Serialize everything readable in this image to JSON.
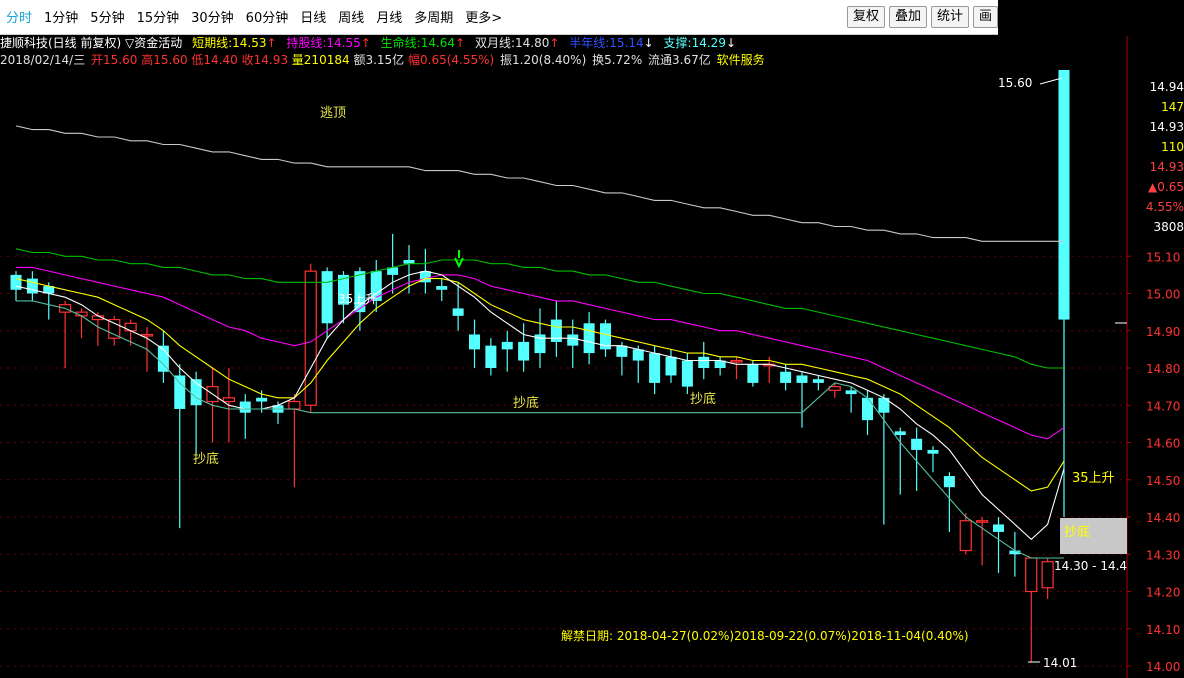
{
  "toolbar": {
    "periods": [
      "分时",
      "1分钟",
      "5分钟",
      "15分钟",
      "30分钟",
      "60分钟",
      "日线",
      "周线",
      "月线",
      "多周期",
      "更多>"
    ],
    "active_period": "分时",
    "buttons": [
      "复权",
      "叠加",
      "统计",
      "画"
    ]
  },
  "info_line1": {
    "title": "捷顺科技(日线 前复权) ▽资金活动",
    "short_label": "短期线:",
    "short_value": "14.53",
    "short_arrow": "↑",
    "hold_label": "持股线:",
    "hold_value": "14.55",
    "hold_arrow": "↑",
    "life_label": "生命线:",
    "life_value": "14.64",
    "life_arrow": "↑",
    "double_label": "双月线:",
    "double_value": "14.80",
    "double_arrow": "↑",
    "half_label": "半年线:",
    "half_value": "15.14",
    "half_arrow": "↓",
    "support_label": "支撑:",
    "support_value": "14.29",
    "support_arrow": "↓"
  },
  "info_line2": {
    "date": "2018/02/14/三",
    "open": "开15.60",
    "high": "高15.60",
    "low": "低14.40",
    "close": "收14.93",
    "volume": "量210184",
    "amount": "额3.15亿",
    "range": "幅0.65(4.55%)",
    "amplitude": "振1.20(8.40%)",
    "turnover": "换5.72%",
    "float": "流通3.67亿",
    "industry": "软件服务"
  },
  "right_panel": {
    "values": [
      "14.94",
      "147",
      "14.93",
      "110",
      "14.93",
      "▲0.65",
      "4.55%",
      "3808"
    ],
    "colors": [
      "#ffffff",
      "#ffff00",
      "#ffffff",
      "#ffff00",
      "#ff4040",
      "#ff4040",
      "#ff4040",
      "#ffffff"
    ]
  },
  "annotations": {
    "escape_top": "逃顶",
    "bottom1": "抄底",
    "bottom2": "抄底",
    "bottom3": "抄底",
    "bottom_box": "抄底",
    "rise1": "35上升",
    "rise2": "35上升",
    "max_price": "15.60",
    "min_price": "14.01",
    "support_range": "14.30 - 14.4",
    "unlock": "解禁日期: 2018-04-27(0.02%)2018-09-22(0.07%)2018-11-04(0.40%)"
  },
  "colors": {
    "up": "#ff3232",
    "down": "#54ffff",
    "short": "#ffffff",
    "hold": "#ffff00",
    "life": "#ff00ff",
    "double": "#00c000",
    "half": "#c8c8c8",
    "support": "#54c0a0",
    "axis": "#b00000"
  },
  "chart_data": {
    "type": "candlestick",
    "title": "捷顺科技(日线 前复权)",
    "ylim": [
      14.0,
      15.6
    ],
    "y_ticks": [
      15.1,
      15.0,
      14.9,
      14.8,
      14.7,
      14.6,
      14.5,
      14.4,
      14.3,
      14.2,
      14.1,
      14.0
    ],
    "candles": [
      {
        "o": 15.05,
        "h": 15.06,
        "c": 15.01,
        "l": 14.98
      },
      {
        "o": 15.04,
        "h": 15.06,
        "c": 15.0,
        "l": 14.98
      },
      {
        "o": 15.02,
        "h": 15.03,
        "c": 15.0,
        "l": 14.93
      },
      {
        "o": 14.95,
        "h": 14.98,
        "c": 14.97,
        "l": 14.8
      },
      {
        "o": 14.94,
        "h": 14.96,
        "c": 14.95,
        "l": 14.88
      },
      {
        "o": 14.93,
        "h": 14.95,
        "c": 14.94,
        "l": 14.86
      },
      {
        "o": 14.88,
        "h": 14.94,
        "c": 14.93,
        "l": 14.86
      },
      {
        "o": 14.9,
        "h": 14.93,
        "c": 14.92,
        "l": 14.86
      },
      {
        "o": 14.89,
        "h": 14.91,
        "c": 14.89,
        "l": 14.79
      },
      {
        "o": 14.86,
        "h": 14.9,
        "c": 14.79,
        "l": 14.76
      },
      {
        "o": 14.78,
        "h": 14.81,
        "c": 14.69,
        "l": 14.37
      },
      {
        "o": 14.77,
        "h": 14.79,
        "c": 14.7,
        "l": 14.57
      },
      {
        "o": 14.71,
        "h": 14.8,
        "c": 14.75,
        "l": 14.6
      },
      {
        "o": 14.71,
        "h": 14.8,
        "c": 14.72,
        "l": 14.6
      },
      {
        "o": 14.71,
        "h": 14.73,
        "c": 14.68,
        "l": 14.61
      },
      {
        "o": 14.72,
        "h": 14.74,
        "c": 14.71,
        "l": 14.68
      },
      {
        "o": 14.7,
        "h": 14.71,
        "c": 14.68,
        "l": 14.65
      },
      {
        "o": 14.69,
        "h": 14.73,
        "c": 14.71,
        "l": 14.48
      },
      {
        "o": 14.7,
        "h": 15.08,
        "c": 15.06,
        "l": 14.68
      },
      {
        "o": 15.06,
        "h": 15.07,
        "c": 14.92,
        "l": 14.88
      },
      {
        "o": 15.05,
        "h": 15.06,
        "c": 14.97,
        "l": 14.92
      },
      {
        "o": 15.06,
        "h": 15.07,
        "c": 14.95,
        "l": 14.9
      },
      {
        "o": 15.06,
        "h": 15.09,
        "c": 14.98,
        "l": 14.95
      },
      {
        "o": 15.07,
        "h": 15.16,
        "c": 15.05,
        "l": 15.0
      },
      {
        "o": 15.09,
        "h": 15.13,
        "c": 15.08,
        "l": 15.0
      },
      {
        "o": 15.06,
        "h": 15.12,
        "c": 15.03,
        "l": 15.0
      },
      {
        "o": 15.02,
        "h": 15.04,
        "c": 15.01,
        "l": 14.98
      },
      {
        "o": 14.96,
        "h": 15.03,
        "c": 14.94,
        "l": 14.9
      },
      {
        "o": 14.89,
        "h": 14.93,
        "c": 14.85,
        "l": 14.8
      },
      {
        "o": 14.86,
        "h": 14.88,
        "c": 14.8,
        "l": 14.78
      },
      {
        "o": 14.87,
        "h": 14.9,
        "c": 14.85,
        "l": 14.79
      },
      {
        "o": 14.87,
        "h": 14.92,
        "c": 14.82,
        "l": 14.79
      },
      {
        "o": 14.89,
        "h": 14.96,
        "c": 14.84,
        "l": 14.8
      },
      {
        "o": 14.93,
        "h": 14.98,
        "c": 14.87,
        "l": 14.83
      },
      {
        "o": 14.89,
        "h": 14.93,
        "c": 14.86,
        "l": 14.8
      },
      {
        "o": 14.92,
        "h": 14.95,
        "c": 14.84,
        "l": 14.81
      },
      {
        "o": 14.92,
        "h": 14.93,
        "c": 14.85,
        "l": 14.83
      },
      {
        "o": 14.86,
        "h": 14.87,
        "c": 14.83,
        "l": 14.78
      },
      {
        "o": 14.85,
        "h": 14.86,
        "c": 14.82,
        "l": 14.76
      },
      {
        "o": 14.84,
        "h": 14.86,
        "c": 14.76,
        "l": 14.73
      },
      {
        "o": 14.83,
        "h": 14.85,
        "c": 14.78,
        "l": 14.76
      },
      {
        "o": 14.82,
        "h": 14.84,
        "c": 14.75,
        "l": 14.73
      },
      {
        "o": 14.83,
        "h": 14.87,
        "c": 14.8,
        "l": 14.77
      },
      {
        "o": 14.82,
        "h": 14.83,
        "c": 14.8,
        "l": 14.78
      },
      {
        "o": 14.82,
        "h": 14.83,
        "c": 14.82,
        "l": 14.77
      },
      {
        "o": 14.81,
        "h": 14.82,
        "c": 14.76,
        "l": 14.75
      },
      {
        "o": 14.81,
        "h": 14.83,
        "c": 14.81,
        "l": 14.76
      },
      {
        "o": 14.79,
        "h": 14.81,
        "c": 14.76,
        "l": 14.74
      },
      {
        "o": 14.78,
        "h": 14.79,
        "c": 14.76,
        "l": 14.64
      },
      {
        "o": 14.77,
        "h": 14.78,
        "c": 14.76,
        "l": 14.74
      },
      {
        "o": 14.74,
        "h": 14.76,
        "c": 14.75,
        "l": 14.72
      },
      {
        "o": 14.74,
        "h": 14.75,
        "c": 14.73,
        "l": 14.68
      },
      {
        "o": 14.72,
        "h": 14.74,
        "c": 14.66,
        "l": 14.62
      },
      {
        "o": 14.72,
        "h": 14.73,
        "c": 14.68,
        "l": 14.38
      },
      {
        "o": 14.63,
        "h": 14.64,
        "c": 14.62,
        "l": 14.46
      },
      {
        "o": 14.61,
        "h": 14.64,
        "c": 14.58,
        "l": 14.47
      },
      {
        "o": 14.58,
        "h": 14.59,
        "c": 14.57,
        "l": 14.52
      },
      {
        "o": 14.51,
        "h": 14.52,
        "c": 14.48,
        "l": 14.36
      },
      {
        "o": 14.31,
        "h": 14.41,
        "c": 14.39,
        "l": 14.3
      },
      {
        "o": 14.39,
        "h": 14.4,
        "c": 14.39,
        "l": 14.27
      },
      {
        "o": 14.38,
        "h": 14.4,
        "c": 14.36,
        "l": 14.25
      },
      {
        "o": 14.31,
        "h": 14.36,
        "c": 14.3,
        "l": 14.24
      },
      {
        "o": 14.2,
        "h": 14.29,
        "c": 14.29,
        "l": 14.01
      },
      {
        "o": 14.21,
        "h": 14.29,
        "c": 14.28,
        "l": 14.18
      },
      {
        "o": 15.6,
        "h": 15.6,
        "c": 14.93,
        "l": 14.4
      }
    ],
    "ma_series": {
      "short": [
        15.02,
        15.01,
        15.0,
        14.99,
        14.97,
        14.94,
        14.92,
        14.9,
        14.88,
        14.85,
        14.8,
        14.76,
        14.73,
        14.7,
        14.69,
        14.69,
        14.7,
        14.72,
        14.8,
        14.88,
        14.93,
        14.97,
        15.0,
        15.03,
        15.05,
        15.06,
        15.05,
        15.02,
        14.99,
        14.95,
        14.92,
        14.89,
        14.88,
        14.88,
        14.88,
        14.87,
        14.86,
        14.86,
        14.85,
        14.84,
        14.83,
        14.82,
        14.82,
        14.82,
        14.81,
        14.81,
        14.81,
        14.8,
        14.79,
        14.78,
        14.77,
        14.76,
        14.74,
        14.72,
        14.69,
        14.65,
        14.62,
        14.58,
        14.52,
        14.46,
        14.42,
        14.38,
        14.34,
        14.38,
        14.53
      ],
      "hold": [
        15.04,
        15.03,
        15.02,
        15.01,
        15.0,
        14.99,
        14.97,
        14.95,
        14.93,
        14.9,
        14.86,
        14.83,
        14.8,
        14.77,
        14.75,
        14.73,
        14.72,
        14.72,
        14.76,
        14.82,
        14.87,
        14.92,
        14.96,
        14.99,
        15.02,
        15.04,
        15.04,
        15.03,
        15.0,
        14.97,
        14.95,
        14.93,
        14.92,
        14.91,
        14.91,
        14.9,
        14.89,
        14.88,
        14.87,
        14.86,
        14.85,
        14.84,
        14.84,
        14.83,
        14.83,
        14.82,
        14.82,
        14.81,
        14.81,
        14.8,
        14.79,
        14.78,
        14.77,
        14.75,
        14.73,
        14.7,
        14.67,
        14.64,
        14.6,
        14.56,
        14.53,
        14.5,
        14.47,
        14.48,
        14.55
      ],
      "life": [
        15.07,
        15.07,
        15.06,
        15.05,
        15.04,
        15.03,
        15.02,
        15.01,
        15.0,
        14.99,
        14.97,
        14.95,
        14.93,
        14.91,
        14.9,
        14.88,
        14.87,
        14.86,
        14.87,
        14.9,
        14.93,
        14.96,
        14.99,
        15.01,
        15.03,
        15.04,
        15.05,
        15.05,
        15.04,
        15.02,
        15.01,
        15.0,
        14.99,
        14.98,
        14.98,
        14.97,
        14.96,
        14.95,
        14.94,
        14.93,
        14.93,
        14.92,
        14.91,
        14.9,
        14.9,
        14.89,
        14.88,
        14.87,
        14.86,
        14.85,
        14.84,
        14.83,
        14.82,
        14.8,
        14.78,
        14.76,
        14.74,
        14.72,
        14.7,
        14.68,
        14.66,
        14.64,
        14.62,
        14.61,
        14.64
      ],
      "double": [
        15.12,
        15.11,
        15.11,
        15.1,
        15.1,
        15.09,
        15.09,
        15.08,
        15.08,
        15.07,
        15.07,
        15.06,
        15.05,
        15.05,
        15.04,
        15.04,
        15.03,
        15.03,
        15.03,
        15.03,
        15.04,
        15.05,
        15.06,
        15.07,
        15.08,
        15.08,
        15.09,
        15.09,
        15.09,
        15.08,
        15.08,
        15.07,
        15.07,
        15.06,
        15.06,
        15.05,
        15.05,
        15.04,
        15.03,
        15.03,
        15.02,
        15.01,
        15.0,
        15.0,
        14.99,
        14.98,
        14.97,
        14.96,
        14.96,
        14.95,
        14.94,
        14.93,
        14.92,
        14.91,
        14.9,
        14.89,
        14.88,
        14.87,
        14.86,
        14.85,
        14.84,
        14.83,
        14.81,
        14.8,
        14.8
      ],
      "half": [
        15.45,
        15.44,
        15.44,
        15.43,
        15.43,
        15.42,
        15.42,
        15.41,
        15.41,
        15.4,
        15.4,
        15.39,
        15.38,
        15.38,
        15.37,
        15.36,
        15.36,
        15.35,
        15.35,
        15.34,
        15.34,
        15.34,
        15.34,
        15.34,
        15.34,
        15.33,
        15.33,
        15.33,
        15.32,
        15.32,
        15.31,
        15.31,
        15.3,
        15.29,
        15.29,
        15.28,
        15.27,
        15.27,
        15.26,
        15.25,
        15.25,
        15.24,
        15.23,
        15.23,
        15.22,
        15.21,
        15.21,
        15.2,
        15.19,
        15.19,
        15.18,
        15.18,
        15.17,
        15.17,
        15.16,
        15.16,
        15.15,
        15.15,
        15.15,
        15.14,
        15.14,
        15.14,
        15.14,
        15.14,
        15.14
      ],
      "support": [
        14.98,
        14.98,
        14.97,
        14.96,
        14.94,
        14.91,
        14.89,
        14.87,
        14.85,
        14.81,
        14.76,
        14.72,
        14.7,
        14.69,
        14.69,
        14.69,
        14.69,
        14.69,
        14.68,
        14.68,
        14.68,
        14.68,
        14.68,
        14.68,
        14.68,
        14.68,
        14.68,
        14.68,
        14.68,
        14.68,
        14.68,
        14.68,
        14.68,
        14.68,
        14.68,
        14.68,
        14.68,
        14.68,
        14.68,
        14.68,
        14.68,
        14.68,
        14.68,
        14.68,
        14.68,
        14.68,
        14.68,
        14.68,
        14.68,
        14.72,
        14.76,
        14.75,
        14.72,
        14.66,
        14.6,
        14.55,
        14.5,
        14.45,
        14.4,
        14.37,
        14.34,
        14.31,
        14.29,
        14.29,
        14.29
      ]
    }
  }
}
